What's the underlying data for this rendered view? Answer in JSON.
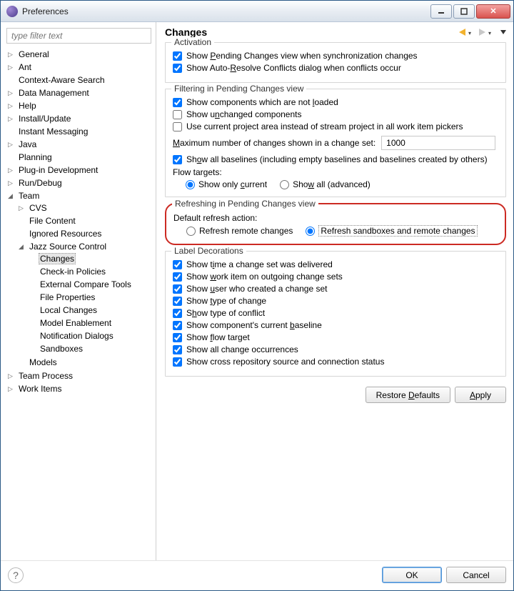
{
  "window": {
    "title": "Preferences"
  },
  "filter_placeholder": "type filter text",
  "tree": {
    "general": "General",
    "ant": "Ant",
    "context_aware": "Context-Aware Search",
    "data_mgmt": "Data Management",
    "help": "Help",
    "install": "Install/Update",
    "im": "Instant Messaging",
    "java": "Java",
    "planning": "Planning",
    "plugin": "Plug-in Development",
    "rundebug": "Run/Debug",
    "team": "Team",
    "cvs": "CVS",
    "filecontent": "File Content",
    "ignored": "Ignored Resources",
    "jsc": "Jazz Source Control",
    "changes": "Changes",
    "checkin": "Check-in Policies",
    "extcompare": "External Compare Tools",
    "fileprops": "File Properties",
    "localchanges": "Local Changes",
    "modelen": "Model Enablement",
    "notif": "Notification Dialogs",
    "sandboxes": "Sandboxes",
    "models": "Models",
    "teamprocess": "Team Process",
    "workitems": "Work Items"
  },
  "page": {
    "title": "Changes",
    "activation": {
      "legend": "Activation",
      "show_pending": "Show Pending Changes view when synchronization changes",
      "show_autoresolve": "Show Auto-Resolve Conflicts dialog when conflicts occur"
    },
    "filtering": {
      "legend": "Filtering in Pending Changes view",
      "show_not_loaded": "Show components which are not loaded",
      "show_unchanged": "Show unchanged components",
      "use_current_project": "Use current project area instead of stream project in all work item pickers",
      "max_label": "Maximum number of changes shown in a change set:",
      "max_value": "1000",
      "show_all_baselines": "Show all baselines (including empty baselines and baselines created by others)",
      "flow_targets": "Flow targets:",
      "flow_current": "Show only current",
      "flow_all": "Show all (advanced)"
    },
    "refreshing": {
      "legend": "Refreshing in Pending Changes view",
      "default_label": "Default refresh action:",
      "remote_only": "Refresh remote changes",
      "sandbox_remote": "Refresh sandboxes and remote changes"
    },
    "labeldec": {
      "legend": "Label Decorations",
      "time_delivered": "Show time a change set was delivered",
      "work_item": "Show work item on outgoing change sets",
      "user_created": "Show user who created a change set",
      "type_change": "Show type of change",
      "type_conflict": "Show type of conflict",
      "component_baseline": "Show component's current baseline",
      "flow_target": "Show flow target",
      "all_occurrences": "Show all change occurrences",
      "cross_repo": "Show cross repository source and connection status"
    },
    "buttons": {
      "restore": "Restore Defaults",
      "apply": "Apply",
      "ok": "OK",
      "cancel": "Cancel"
    }
  }
}
